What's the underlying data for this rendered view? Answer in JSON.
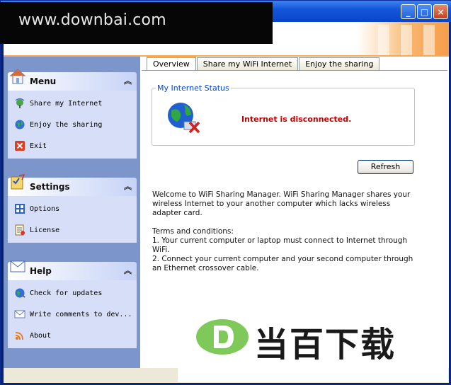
{
  "watermark_top": "www.downbai.com",
  "watermark_bottom": "当百下载",
  "window": {
    "minimize": "_",
    "maximize": "□",
    "close": "×"
  },
  "sidebar": {
    "groups": [
      {
        "title": "Menu",
        "icon": "home-icon",
        "items": [
          {
            "label": "Share my Internet",
            "icon": "share-icon"
          },
          {
            "label": "Enjoy the sharing",
            "icon": "globe-icon"
          },
          {
            "label": "Exit",
            "icon": "exit-icon"
          }
        ]
      },
      {
        "title": "Settings",
        "icon": "settings-icon",
        "items": [
          {
            "label": "Options",
            "icon": "options-icon"
          },
          {
            "label": "License",
            "icon": "license-icon"
          }
        ]
      },
      {
        "title": "Help",
        "icon": "help-icon",
        "items": [
          {
            "label": "Check for updates",
            "icon": "update-icon"
          },
          {
            "label": "Write comments to dev...",
            "icon": "mail-icon"
          },
          {
            "label": "About",
            "icon": "about-icon"
          }
        ]
      }
    ]
  },
  "tabs": [
    "Overview",
    "Share my WiFi Internet",
    "Enjoy the sharing"
  ],
  "status": {
    "legend": "My Internet Status",
    "message": "Internet is disconnected.",
    "color": "#c00000"
  },
  "refresh_label": "Refresh",
  "description": {
    "welcome": "Welcome to WiFi Sharing Manager. WiFi Sharing Manager shares your wireless Internet to your another computer which lacks wireless adapter card.",
    "terms_title": "Terms and conditions:",
    "term1": "1. Your current computer or laptop must connect to Internet through WiFi.",
    "term2": "2. Connect your current computer and your second computer through an Ethernet crossover cable."
  }
}
